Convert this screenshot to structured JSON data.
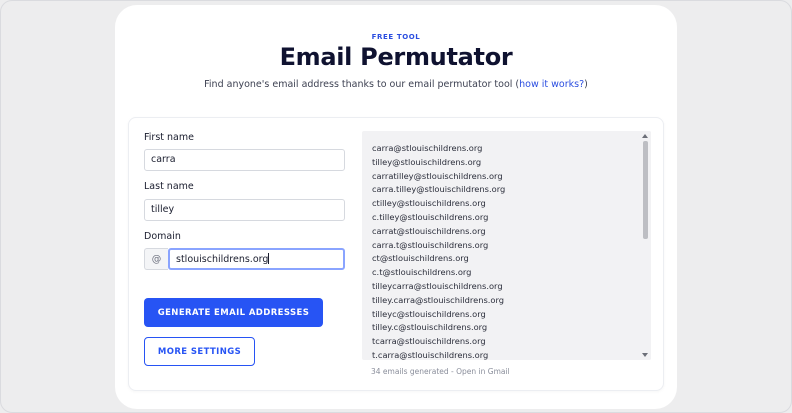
{
  "header": {
    "eyebrow": "FREE TOOL",
    "title": "Email Permutator",
    "subtitle_prefix": "Find anyone's email address thanks to our email permutator tool (",
    "subtitle_link": "how it works?",
    "subtitle_suffix": ")"
  },
  "form": {
    "first_name_label": "First name",
    "first_name_value": "carra",
    "last_name_label": "Last name",
    "last_name_value": "tilley",
    "domain_label": "Domain",
    "domain_prefix": "@",
    "domain_value": "stlouischildrens.org",
    "generate_label": "GENERATE EMAIL ADDRESSES",
    "settings_label": "MORE SETTINGS"
  },
  "results": {
    "emails": [
      "carra@stlouischildrens.org",
      "tilley@stlouischildrens.org",
      "carratilley@stlouischildrens.org",
      "carra.tilley@stlouischildrens.org",
      "ctilley@stlouischildrens.org",
      "c.tilley@stlouischildrens.org",
      "carrat@stlouischildrens.org",
      "carra.t@stlouischildrens.org",
      "ct@stlouischildrens.org",
      "c.t@stlouischildrens.org",
      "tilleycarra@stlouischildrens.org",
      "tilley.carra@stlouischildrens.org",
      "tilleyc@stlouischildrens.org",
      "tilley.c@stlouischildrens.org",
      "tcarra@stlouischildrens.org",
      "t.carra@stlouischildrens.org"
    ],
    "count_text": "34 emails generated",
    "separator": "-",
    "gmail_link": "Open in Gmail"
  },
  "colors": {
    "accent": "#2754f4",
    "link": "#2b4ee0",
    "title": "#0f1230",
    "background": "#ededee"
  }
}
